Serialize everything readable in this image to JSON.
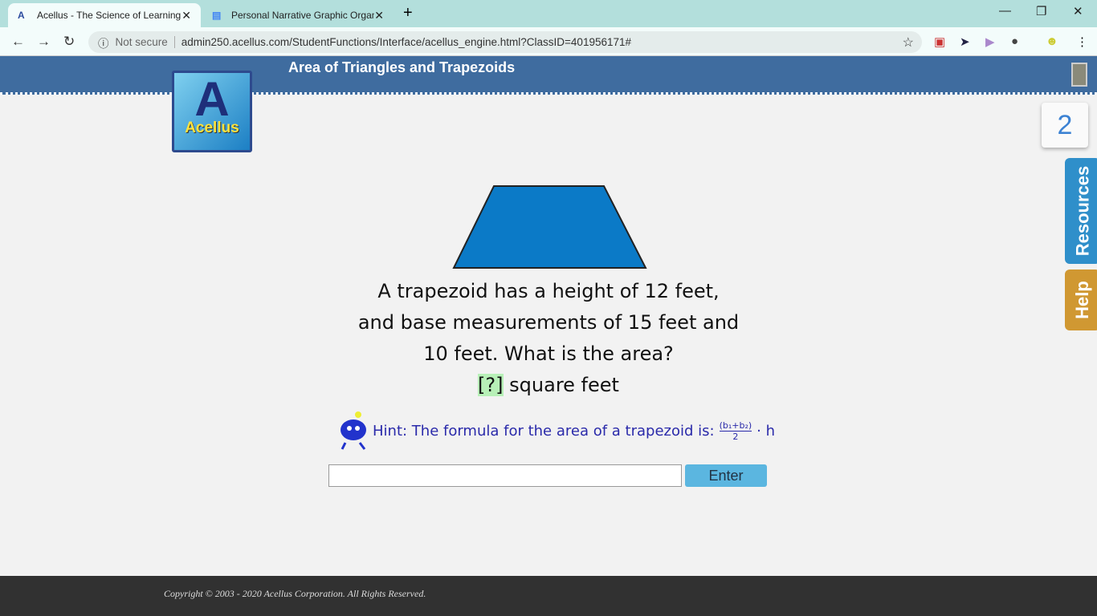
{
  "browser": {
    "tabs": [
      {
        "label": "Acellus - The Science of Learning",
        "icon": "acellus-icon"
      },
      {
        "label": "Personal Narrative Graphic Organ",
        "icon": "docs-icon"
      }
    ],
    "security": "Not secure",
    "url": "admin250.acellus.com/StudentFunctions/Interface/acellus_engine.html?ClassID=401956171#"
  },
  "lesson": {
    "title": "Area of Triangles and Trapezoids",
    "logo_text": "Acellus",
    "counter": "2",
    "resources": "Resources",
    "help": "Help"
  },
  "question": {
    "lines": [
      "A trapezoid has a height of 12 feet,",
      "and base measurements of 15 feet and",
      "10 feet. What is the area?"
    ],
    "blank": "[?]",
    "unit": "square feet"
  },
  "hint": {
    "text": "Hint: The formula for the area of a trapezoid is:",
    "numerator": "(b₁+b₂)",
    "denominator": "2",
    "tail": "· h"
  },
  "answer": {
    "value": "",
    "enter": "Enter"
  },
  "footer": {
    "copyright": "Copyright © 2003 - 2020 Acellus Corporation.  All Rights Reserved."
  }
}
